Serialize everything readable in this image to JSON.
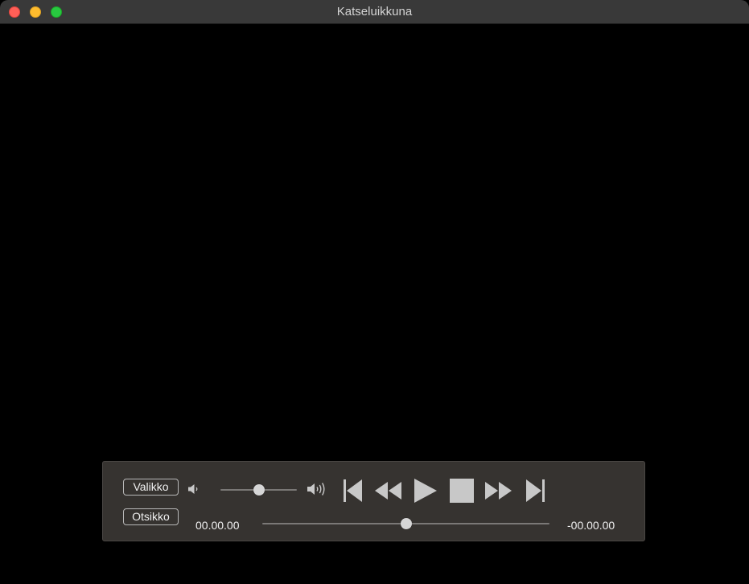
{
  "window": {
    "title": "Katseluikkuna"
  },
  "controller": {
    "menu_label": "Valikko",
    "title_label": "Otsikko",
    "volume_fraction": 0.5,
    "seek_fraction": 0.5,
    "time_elapsed": "00.00.00",
    "time_remaining": "-00.00.00",
    "icons": {
      "volume_low": "speaker-low-icon",
      "volume_high": "speaker-high-icon",
      "previous": "skip-back-icon",
      "rewind": "rewind-icon",
      "play": "play-icon",
      "stop": "stop-icon",
      "fast_forward": "fast-forward-icon",
      "next": "skip-forward-icon"
    }
  },
  "colors": {
    "titlebar": "#393939",
    "controller_bg": "#363330",
    "icon_gray": "#c8c8c8",
    "close": "#ff5f57",
    "minimize": "#febc2e",
    "maximize": "#28c840"
  }
}
